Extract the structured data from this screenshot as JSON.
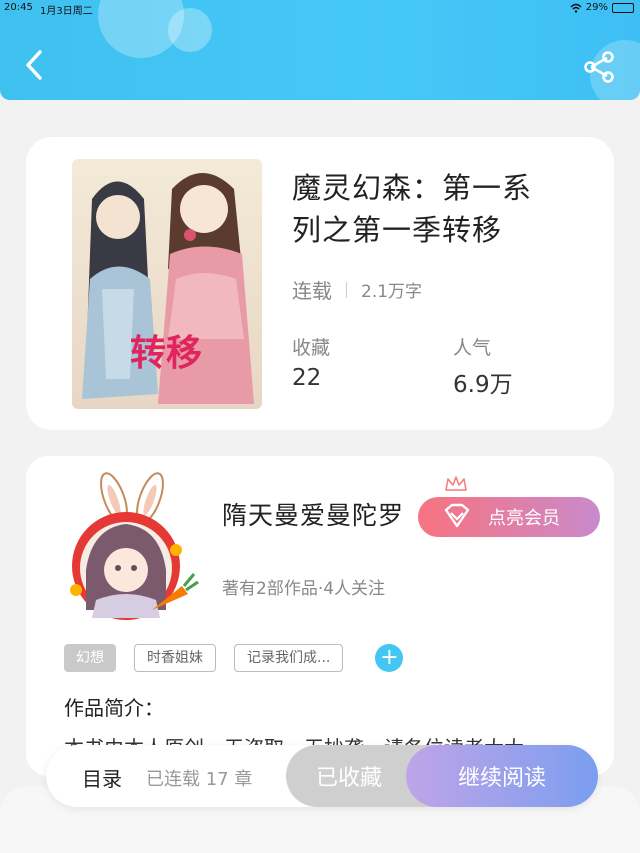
{
  "status_bar": {
    "time": "20:45",
    "date": "1月3日周二",
    "battery": "29%",
    "battery_level": 0.29
  },
  "header": {
    "back_icon": "chevron-left-icon",
    "share_icon": "share-icon"
  },
  "book": {
    "title_line1": "魔灵幻森：第一系",
    "title_line2": "列之第一季转移",
    "status": "连载",
    "word_count": "2.1万字",
    "favorites_label": "收藏",
    "favorites_value": "22",
    "popularity_label": "人气",
    "popularity_value": "6.9万",
    "cover_text": "转移"
  },
  "author": {
    "name": "隋天曼爱曼陀罗",
    "vip_button": "点亮会员",
    "subtitle": "著有2部作品·4人关注",
    "tags": [
      "幻想",
      "时香姐妹",
      "记录我们成..."
    ],
    "add_tag": "+",
    "intro_label": "作品简介：",
    "intro_text": "本书由本人原创，无盗取，无抄袭，请各位读者大大"
  },
  "bottom_bar": {
    "toc_label": "目录",
    "toc_count": "已连载 17 章",
    "favorited_button": "已收藏",
    "continue_button": "继续阅读"
  },
  "colors": {
    "header": "#45c8f7",
    "vip_start": "#f8737f",
    "vip_end": "#c98acb",
    "read_start": "#bfa4e8",
    "read_end": "#7b9ef0",
    "tag_add": "#43c6f2"
  }
}
